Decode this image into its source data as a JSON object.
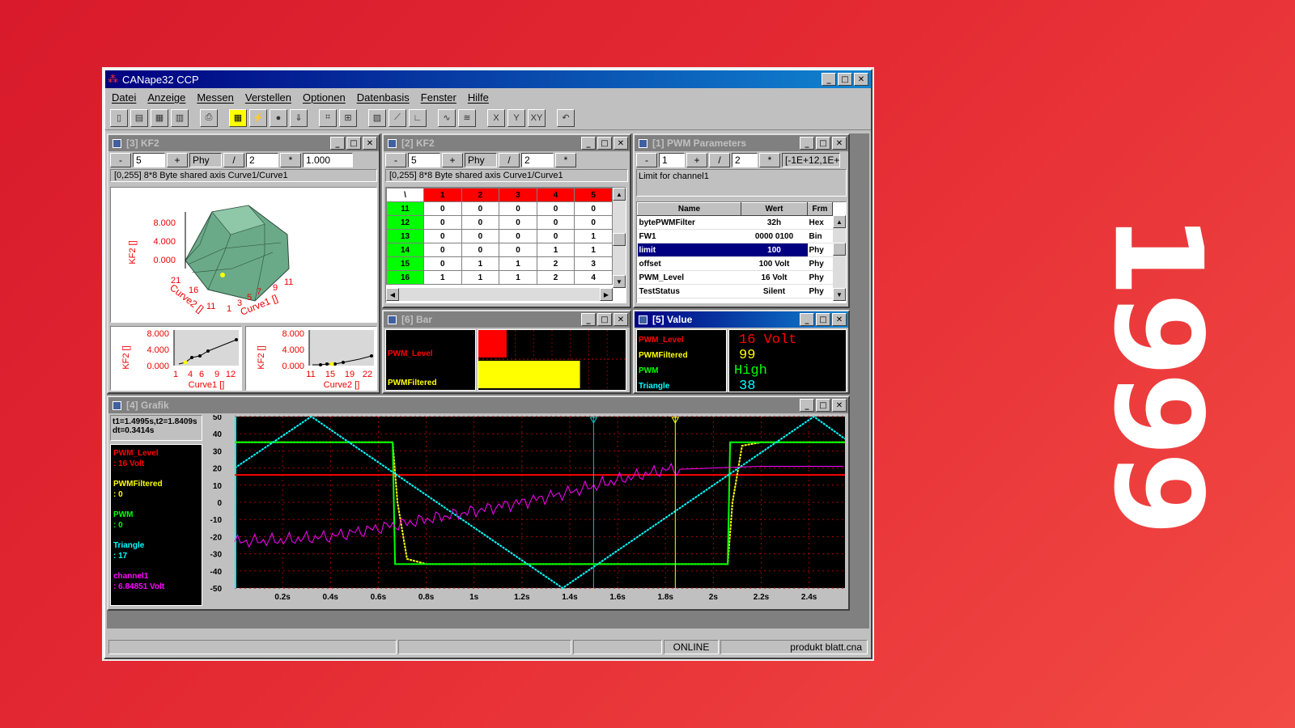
{
  "year": "1999",
  "app": {
    "title": "CANape32 CCP"
  },
  "menu": [
    "Datei",
    "Anzeige",
    "Messen",
    "Verstellen",
    "Optionen",
    "Datenbasis",
    "Fenster",
    "Hilfe"
  ],
  "kf2_3d": {
    "title": "[3] KF2",
    "minus": "-",
    "value": "5",
    "plus": "+",
    "mode": "Phy",
    "div": "/",
    "step": "2",
    "mul": "*",
    "factor": "1.000",
    "info": "[0,255]   8*8 Byte shared axis Curve1/Curve1",
    "zlabel": "KF2 []",
    "z_ticks": [
      "8.000",
      "4.000",
      "0.000"
    ],
    "curve2_label": "Curve2 []",
    "curve1_label": "Curve1 []",
    "c2_ticks": [
      "21",
      "16",
      "11"
    ],
    "c1_ticks": [
      "1",
      "3",
      "5",
      "7",
      "9",
      "11"
    ],
    "mini1": {
      "ylabel": "KF2 []",
      "yticks": [
        "8.000",
        "4.000",
        "0.000"
      ],
      "xticks": [
        "1",
        "4",
        "6",
        "9",
        "12"
      ],
      "xlabel": "Curve1 []"
    },
    "mini2": {
      "ylabel": "KF2 []",
      "yticks": [
        "8.000",
        "4.000",
        "0.000"
      ],
      "xticks": [
        "11",
        "15",
        "19",
        "22"
      ],
      "xlabel": "Curve2 []"
    }
  },
  "kf2_table": {
    "title": "[2] KF2",
    "minus": "-",
    "value": "5",
    "plus": "+",
    "mode": "Phy",
    "div": "/",
    "step": "2",
    "mul": "*",
    "info": "[0,255]   8*8 Byte shared axis Curve1/Curve1",
    "corner": "\\",
    "cols": [
      "1",
      "2",
      "3",
      "4",
      "5"
    ],
    "rows": [
      {
        "h": "11",
        "v": [
          "0",
          "0",
          "0",
          "0",
          "0"
        ]
      },
      {
        "h": "12",
        "v": [
          "0",
          "0",
          "0",
          "0",
          "0"
        ]
      },
      {
        "h": "13",
        "v": [
          "0",
          "0",
          "0",
          "0",
          "1"
        ]
      },
      {
        "h": "14",
        "v": [
          "0",
          "0",
          "0",
          "1",
          "1"
        ]
      },
      {
        "h": "15",
        "v": [
          "0",
          "1",
          "1",
          "2",
          "3"
        ]
      },
      {
        "h": "16",
        "v": [
          "1",
          "1",
          "1",
          "2",
          "4"
        ]
      }
    ]
  },
  "pwm": {
    "title": "[1] PWM Parameters",
    "minus": "-",
    "value": "1",
    "plus": "+",
    "div": "/",
    "step": "2",
    "mul": "*",
    "range": "[-1E+12,1E+",
    "desc": "Limit for channel1",
    "headers": [
      "Name",
      "Wert",
      "Frm"
    ],
    "rows": [
      {
        "n": "bytePWMFilter",
        "w": "32h",
        "f": "Hex"
      },
      {
        "n": "FW1",
        "w": "0000 0100",
        "f": "Bin"
      },
      {
        "n": "limit",
        "w": "100",
        "f": "Phy"
      },
      {
        "n": "offset",
        "w": "100 Volt",
        "f": "Phy"
      },
      {
        "n": "PWM_Level",
        "w": "16 Volt",
        "f": "Phy"
      },
      {
        "n": "TestStatus",
        "w": "Silent",
        "f": "Phy"
      }
    ]
  },
  "bar": {
    "title": "[6] Bar",
    "labels": [
      "PWM_Level",
      "PWMFiltered"
    ],
    "levels": [
      0.12,
      0.75
    ],
    "colors": [
      "#ff0000",
      "#ffff00"
    ]
  },
  "value": {
    "title": "[5] Value",
    "items": [
      {
        "label": "PWM_Level",
        "value": "16 Volt",
        "color": "#ff0000"
      },
      {
        "label": "PWMFiltered",
        "value": "99",
        "color": "#ffff00"
      },
      {
        "label": "PWM",
        "value": "High",
        "color": "#00ff00"
      },
      {
        "label": "Triangle",
        "value": "38",
        "color": "#00ffff"
      }
    ]
  },
  "grafik": {
    "title": "[4] Grafik",
    "cursor_info": [
      "t1=1.4995s,t2=1.8409s",
      "dt=0.3414s"
    ],
    "legend": [
      {
        "name": "PWM_Level",
        "val": ": 16 Volt",
        "color": "#ff0000"
      },
      {
        "name": "PWMFiltered",
        "val": ": 0",
        "color": "#ffff00"
      },
      {
        "name": "PWM",
        "val": ": 0",
        "color": "#00ff00"
      },
      {
        "name": "Triangle",
        "val": ": 17",
        "color": "#00ffff"
      },
      {
        "name": "channel1",
        "val": ": 6.84851 Volt",
        "color": "#ff00ff"
      }
    ]
  },
  "chart_data": {
    "type": "line",
    "xlim": [
      0,
      2.55
    ],
    "ylim": [
      -50,
      50
    ],
    "x_ticks": [
      "0.2s",
      "0.4s",
      "0.6s",
      "0.8s",
      "1s",
      "1.2s",
      "1.4s",
      "1.6s",
      "1.8s",
      "2s",
      "2.2s",
      "2.4s"
    ],
    "x_tick_values": [
      0.2,
      0.4,
      0.6,
      0.8,
      1.0,
      1.2,
      1.4,
      1.6,
      1.8,
      2.0,
      2.2,
      2.4
    ],
    "y_ticks": [
      "50",
      "40",
      "30",
      "20",
      "10",
      "0",
      "-10",
      "-20",
      "-30",
      "-40",
      "-50"
    ],
    "cursors": [
      1.4995,
      1.8409
    ],
    "series": [
      {
        "name": "PWM_Level",
        "color": "#ff0000",
        "x": [
          0,
          2.55
        ],
        "y": [
          16,
          16
        ]
      },
      {
        "name": "PWMFiltered",
        "color": "#ffff00",
        "x": [
          0,
          0.66,
          0.68,
          0.72,
          0.8,
          2.06,
          2.08,
          2.12,
          2.2,
          2.55
        ],
        "y": [
          35,
          35,
          0,
          -33,
          -36,
          -36,
          0,
          33,
          35,
          35
        ]
      },
      {
        "name": "PWM",
        "color": "#00ff00",
        "x": [
          0,
          0.66,
          0.67,
          2.06,
          2.07,
          2.55
        ],
        "y": [
          35,
          35,
          -36,
          -36,
          35,
          35
        ]
      },
      {
        "name": "Triangle",
        "color": "#00ffff",
        "x": [
          0,
          0.32,
          1.37,
          2.42,
          2.55
        ],
        "y": [
          20,
          50,
          -50,
          50,
          37
        ]
      },
      {
        "name": "channel1",
        "color": "#ff00ff",
        "x": [
          0,
          0.2,
          0.4,
          0.6,
          0.8,
          1.0,
          1.2,
          1.4,
          1.6,
          1.8,
          2.0,
          2.2,
          2.4,
          2.55
        ],
        "y": [
          -23,
          -22,
          -20,
          -15,
          -10,
          -5,
          0,
          6,
          13,
          19,
          20,
          21,
          21,
          21
        ]
      }
    ]
  },
  "status": {
    "online": "ONLINE",
    "file": "produkt blatt.cna"
  }
}
